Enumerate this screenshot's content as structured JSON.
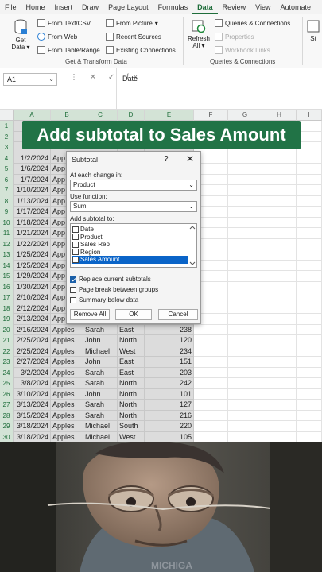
{
  "ribbon_tabs": [
    "File",
    "Home",
    "Insert",
    "Draw",
    "Page Layout",
    "Formulas",
    "Data",
    "Review",
    "View",
    "Automate"
  ],
  "active_tab": "Data",
  "ribbon": {
    "get_data": "Get Data",
    "get_data_line1": "Get",
    "get_data_line2": "Data",
    "from_text_csv": "From Text/CSV",
    "from_web": "From Web",
    "from_table_range": "From Table/Range",
    "from_picture": "From Picture",
    "recent_sources": "Recent Sources",
    "existing_connections": "Existing Connections",
    "group_get_transform": "Get & Transform Data",
    "refresh_all_line1": "Refresh",
    "refresh_all_line2": "All",
    "queries_connections": "Queries & Connections",
    "properties": "Properties",
    "workbook_links": "Workbook Links",
    "group_queries": "Queries & Connections",
    "cut_off": "St"
  },
  "formula_bar": {
    "name_box": "A1",
    "icons": "⋮ ✕ ✓ fx",
    "value": "Date"
  },
  "columns": [
    "A",
    "B",
    "C",
    "D",
    "E",
    "F",
    "G",
    "H",
    "I"
  ],
  "banner": "Add subtotal to Sales Amount",
  "rows": [
    {
      "n": "1",
      "a": "Da",
      "b": "",
      "c": "",
      "d": "",
      "e": ""
    },
    {
      "n": "2",
      "a": "",
      "b": "",
      "c": "",
      "d": "",
      "e": ""
    },
    {
      "n": "3",
      "a": "",
      "b": "",
      "c": "",
      "d": "",
      "e": ""
    },
    {
      "n": "4",
      "a": "1/2/2024",
      "b": "App",
      "c": "",
      "d": "",
      "e": ""
    },
    {
      "n": "5",
      "a": "1/6/2024",
      "b": "App",
      "c": "",
      "d": "",
      "e": ""
    },
    {
      "n": "6",
      "a": "1/7/2024",
      "b": "App",
      "c": "",
      "d": "",
      "e": ""
    },
    {
      "n": "7",
      "a": "1/10/2024",
      "b": "App",
      "c": "",
      "d": "",
      "e": ""
    },
    {
      "n": "8",
      "a": "1/13/2024",
      "b": "App",
      "c": "",
      "d": "",
      "e": ""
    },
    {
      "n": "9",
      "a": "1/17/2024",
      "b": "App",
      "c": "",
      "d": "",
      "e": ""
    },
    {
      "n": "10",
      "a": "1/18/2024",
      "b": "App",
      "c": "",
      "d": "",
      "e": ""
    },
    {
      "n": "11",
      "a": "1/21/2024",
      "b": "App",
      "c": "",
      "d": "",
      "e": ""
    },
    {
      "n": "12",
      "a": "1/22/2024",
      "b": "App",
      "c": "",
      "d": "",
      "e": ""
    },
    {
      "n": "13",
      "a": "1/25/2024",
      "b": "App",
      "c": "",
      "d": "",
      "e": ""
    },
    {
      "n": "14",
      "a": "1/25/2024",
      "b": "App",
      "c": "",
      "d": "",
      "e": ""
    },
    {
      "n": "15",
      "a": "1/29/2024",
      "b": "App",
      "c": "",
      "d": "",
      "e": ""
    },
    {
      "n": "16",
      "a": "1/30/2024",
      "b": "App",
      "c": "",
      "d": "",
      "e": ""
    },
    {
      "n": "17",
      "a": "2/10/2024",
      "b": "App",
      "c": "",
      "d": "",
      "e": ""
    },
    {
      "n": "18",
      "a": "2/12/2024",
      "b": "App",
      "c": "",
      "d": "",
      "e": ""
    },
    {
      "n": "19",
      "a": "2/13/2024",
      "b": "App",
      "c": "",
      "d": "",
      "e": ""
    },
    {
      "n": "20",
      "a": "2/16/2024",
      "b": "Apples",
      "c": "Sarah",
      "d": "East",
      "e": "238"
    },
    {
      "n": "21",
      "a": "2/25/2024",
      "b": "Apples",
      "c": "John",
      "d": "North",
      "e": "120"
    },
    {
      "n": "22",
      "a": "2/25/2024",
      "b": "Apples",
      "c": "Michael",
      "d": "West",
      "e": "234"
    },
    {
      "n": "23",
      "a": "2/27/2024",
      "b": "Apples",
      "c": "John",
      "d": "East",
      "e": "151"
    },
    {
      "n": "24",
      "a": "3/2/2024",
      "b": "Apples",
      "c": "Sarah",
      "d": "East",
      "e": "203"
    },
    {
      "n": "25",
      "a": "3/8/2024",
      "b": "Apples",
      "c": "Sarah",
      "d": "North",
      "e": "242"
    },
    {
      "n": "26",
      "a": "3/10/2024",
      "b": "Apples",
      "c": "John",
      "d": "North",
      "e": "101"
    },
    {
      "n": "27",
      "a": "3/13/2024",
      "b": "Apples",
      "c": "Sarah",
      "d": "North",
      "e": "127"
    },
    {
      "n": "28",
      "a": "3/15/2024",
      "b": "Apples",
      "c": "Sarah",
      "d": "North",
      "e": "216"
    },
    {
      "n": "29",
      "a": "3/18/2024",
      "b": "Apples",
      "c": "Michael",
      "d": "South",
      "e": "220"
    },
    {
      "n": "30",
      "a": "3/18/2024",
      "b": "Apples",
      "c": "Michael",
      "d": "West",
      "e": "105"
    }
  ],
  "dialog": {
    "title": "Subtotal",
    "help": "?",
    "close": "✕",
    "at_each_change_label": "At each change in:",
    "at_each_change_value": "Product",
    "use_function_label": "Use function:",
    "use_function_value": "Sum",
    "add_subtotal_label": "Add subtotal to:",
    "fields": [
      {
        "label": "Date",
        "checked": false,
        "selected": false
      },
      {
        "label": "Product",
        "checked": false,
        "selected": false
      },
      {
        "label": "Sales Rep",
        "checked": false,
        "selected": false
      },
      {
        "label": "Region",
        "checked": false,
        "selected": false
      },
      {
        "label": "Sales Amount",
        "checked": false,
        "selected": true
      }
    ],
    "replace_current": "Replace current subtotals",
    "replace_checked": true,
    "page_break": "Page break between groups",
    "page_break_checked": false,
    "summary_below": "Summary below data",
    "summary_checked": false,
    "remove_all": "Remove All",
    "ok": "OK",
    "cancel": "Cancel"
  },
  "colors": {
    "accent": "#217346",
    "selection": "#0a64c8"
  }
}
